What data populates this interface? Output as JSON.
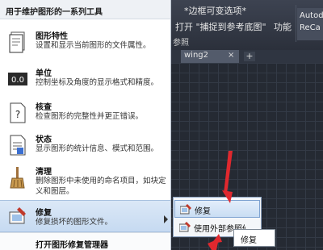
{
  "ribbon": {
    "title_fragment": "*边框可变选项*",
    "capture_action": "打开 \"捕捉到参考底图\"",
    "features_label": "功能",
    "params_label": "参照",
    "autodesk_label": "Autod",
    "recap_label": "ReCa"
  },
  "tabs": [
    {
      "label": "wing2",
      "close": "×"
    }
  ],
  "tab_add": "+",
  "menu": {
    "header": "用于维护图形的一系列工具",
    "items": [
      {
        "title": "图形特性",
        "desc": "设置和显示当前图形的文件属性。",
        "icon": "drawing-properties-icon"
      },
      {
        "title": "单位",
        "desc": "控制坐标及角度的显示格式和精度。",
        "icon": "units-icon",
        "icon_text": "0.0"
      },
      {
        "title": "核查",
        "desc": "检查图形的完整性并更正错误。",
        "icon": "audit-icon",
        "icon_text": "?"
      },
      {
        "title": "状态",
        "desc": "显示图形的统计信息、模式和范围。",
        "icon": "status-icon"
      },
      {
        "title": "清理",
        "desc": "删除图形中未使用的命名项目，如块定义和图层。",
        "icon": "purge-icon"
      },
      {
        "title": "修复",
        "desc": "修复损坏的图形文件。",
        "icon": "recover-icon"
      }
    ],
    "last_item": "打开图形修复管理器"
  },
  "submenu": {
    "items": [
      {
        "label": "修复"
      },
      {
        "label": "使用外部参照修复"
      }
    ]
  },
  "tooltip": "修复",
  "colors": {
    "annotation_arrow": "#e0282e",
    "ribbon_bg": "#2b303b",
    "highlight": "#c6daf1"
  }
}
